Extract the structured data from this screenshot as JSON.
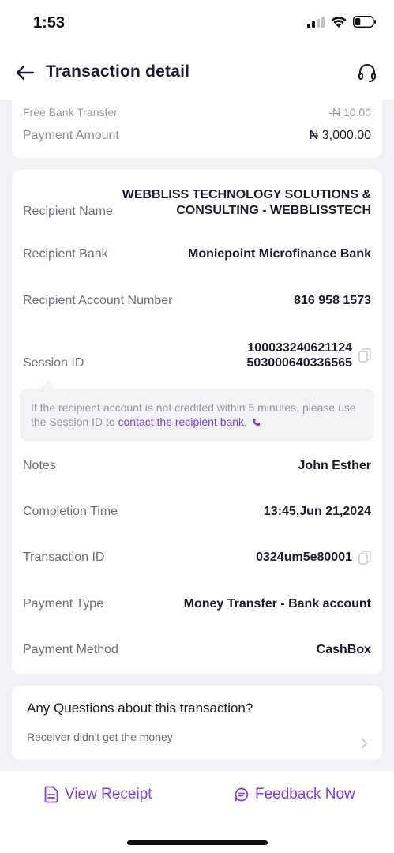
{
  "status_bar": {
    "time": "1:53",
    "battery_level": 0.3
  },
  "header": {
    "title": "Transaction detail"
  },
  "summary": {
    "fee_label": "Free Bank Transfer",
    "fee_value": "-₦ 10.00",
    "amount_label": "Payment Amount",
    "amount_value": "₦ 3,000.00"
  },
  "details": {
    "recipient_name_label": "Recipient Name",
    "recipient_name_line1": "WEBBLISS TECHNOLOGY SOLUTIONS &",
    "recipient_name_line2": "CONSULTING - WEBBLISSTECH",
    "recipient_bank_label": "Recipient Bank",
    "recipient_bank_value": "Moniepoint Microfinance Bank",
    "account_number_label": "Recipient Account Number",
    "account_number_value": "816 958 1573",
    "session_id_label": "Session ID",
    "session_id_line1": "100033240621124",
    "session_id_line2": "503000640336565",
    "notice_text": "If the recipient account is not credited within 5 minutes, please use the Session ID to ",
    "notice_link": "contact the recipient bank.",
    "notes_label": "Notes",
    "notes_value": "John Esther",
    "completion_time_label": "Completion Time",
    "completion_time_value": "13:45,Jun 21,2024",
    "transaction_id_label": "Transaction ID",
    "transaction_id_value": "0324um5e80001",
    "payment_type_label": "Payment Type",
    "payment_type_value": "Money Transfer - Bank account",
    "payment_method_label": "Payment Method",
    "payment_method_value": "CashBox"
  },
  "questions": {
    "title": "Any Questions about this transaction?",
    "item": "Receiver didn't get the money"
  },
  "bottom_bar": {
    "view_receipt": "View Receipt",
    "feedback": "Feedback Now"
  },
  "colors": {
    "accent": "#7b3fe4",
    "background": "#f2f2f6",
    "card": "#ffffff"
  }
}
